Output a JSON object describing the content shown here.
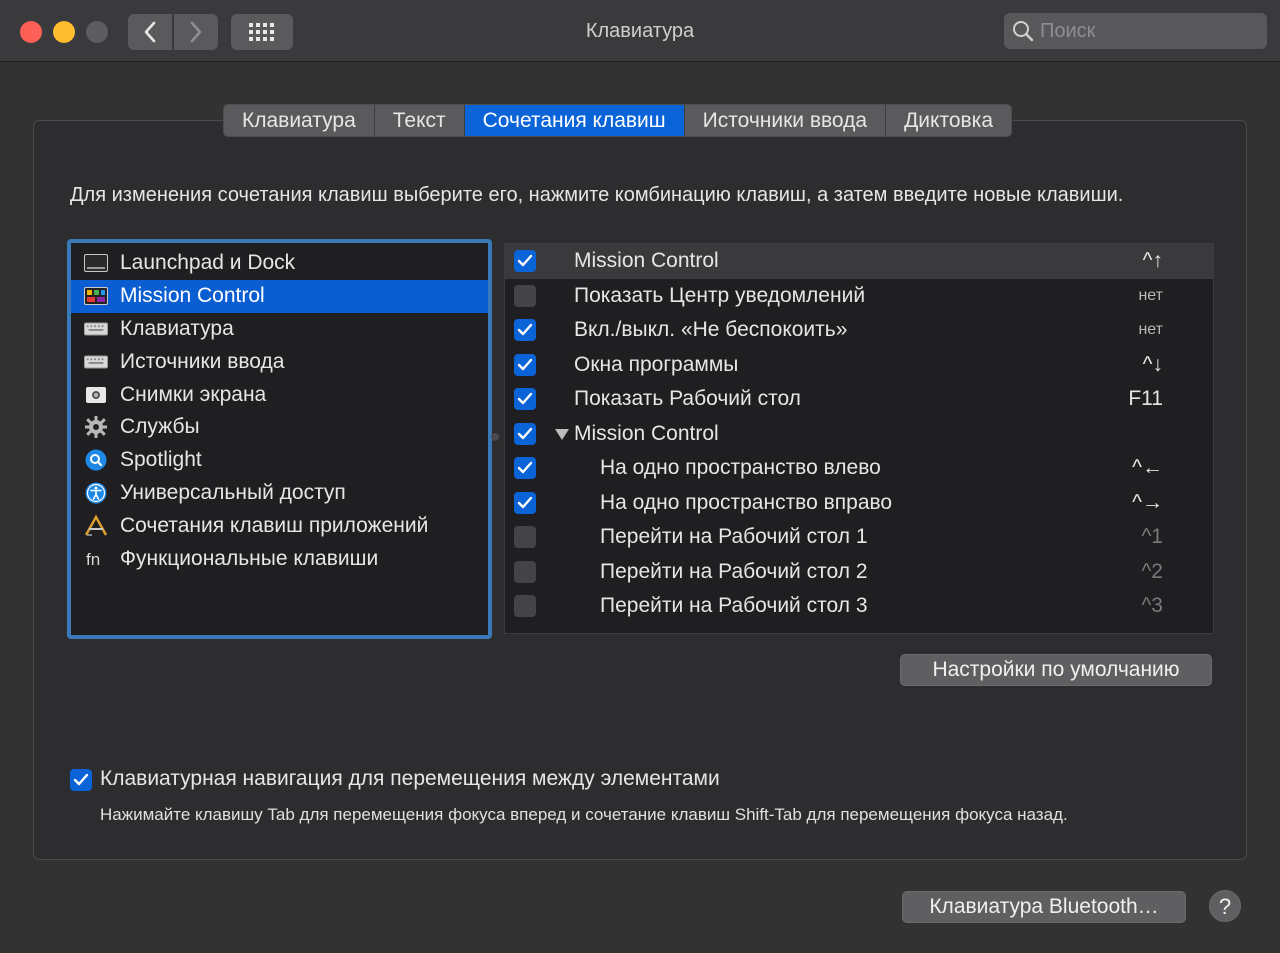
{
  "window": {
    "title": "Клавиатура",
    "search_placeholder": "Поиск"
  },
  "tabs": [
    {
      "label": "Клавиатура",
      "active": false
    },
    {
      "label": "Текст",
      "active": false
    },
    {
      "label": "Сочетания клавиш",
      "active": true
    },
    {
      "label": "Источники ввода",
      "active": false
    },
    {
      "label": "Диктовка",
      "active": false
    }
  ],
  "description": "Для изменения сочетания клавиш выберите его, нажмите комбинацию клавиш, а затем введите новые клавиши.",
  "categories": [
    {
      "label": "Launchpad и Dock",
      "icon": "launchpad-dock-icon",
      "selected": false
    },
    {
      "label": "Mission Control",
      "icon": "mission-control-icon",
      "selected": true
    },
    {
      "label": "Клавиатура",
      "icon": "keyboard-icon",
      "selected": false
    },
    {
      "label": "Источники ввода",
      "icon": "keyboard-icon",
      "selected": false
    },
    {
      "label": "Снимки экрана",
      "icon": "screenshot-icon",
      "selected": false
    },
    {
      "label": "Службы",
      "icon": "gear-icon",
      "selected": false
    },
    {
      "label": "Spotlight",
      "icon": "spotlight-icon",
      "selected": false
    },
    {
      "label": "Универсальный доступ",
      "icon": "accessibility-icon",
      "selected": false
    },
    {
      "label": "Сочетания клавиш приложений",
      "icon": "app-shortcuts-icon",
      "selected": false
    },
    {
      "label": "Функциональные клавиши",
      "icon": "fn-icon",
      "selected": false
    }
  ],
  "shortcuts": [
    {
      "label": "Mission Control",
      "checked": true,
      "shortcut": "^↑",
      "level": 1,
      "highlight": true,
      "style": "normal"
    },
    {
      "label": "Показать Центр уведомлений",
      "checked": false,
      "shortcut": "нет",
      "level": 1,
      "style": "small"
    },
    {
      "label": "Вкл./выкл. «Не беспокоить»",
      "checked": true,
      "shortcut": "нет",
      "level": 1,
      "style": "small"
    },
    {
      "label": "Окна программы",
      "checked": true,
      "shortcut": "^↓",
      "level": 1,
      "style": "normal"
    },
    {
      "label": "Показать Рабочий стол",
      "checked": true,
      "shortcut": "F11",
      "level": 1,
      "style": "normal"
    },
    {
      "label": "Mission Control",
      "checked": true,
      "shortcut": "",
      "level": 1,
      "disclosure": true,
      "style": "normal"
    },
    {
      "label": "На одно пространство влево",
      "checked": true,
      "shortcut": "^←",
      "level": 2,
      "style": "normal"
    },
    {
      "label": "На одно пространство вправо",
      "checked": true,
      "shortcut": "^→",
      "level": 2,
      "style": "normal"
    },
    {
      "label": "Перейти на Рабочий стол 1",
      "checked": false,
      "shortcut": "^1",
      "level": 2,
      "style": "dim"
    },
    {
      "label": "Перейти на Рабочий стол 2",
      "checked": false,
      "shortcut": "^2",
      "level": 2,
      "style": "dim"
    },
    {
      "label": "Перейти на Рабочий стол 3",
      "checked": false,
      "shortcut": "^3",
      "level": 2,
      "style": "dim"
    }
  ],
  "buttons": {
    "defaults": "Настройки по умолчанию",
    "bluetooth": "Клавиатура Bluetooth…",
    "help": "?"
  },
  "keyboard_navigation": {
    "checked": true,
    "label": "Клавиатурная навигация для перемещения между элементами",
    "description": "Нажимайте клавишу Tab для перемещения фокуса вперед и сочетание клавиш Shift-Tab для перемещения фокуса назад."
  },
  "colors": {
    "accent": "#0a64d8",
    "close": "#fe5f57",
    "minimize": "#febc2e"
  }
}
